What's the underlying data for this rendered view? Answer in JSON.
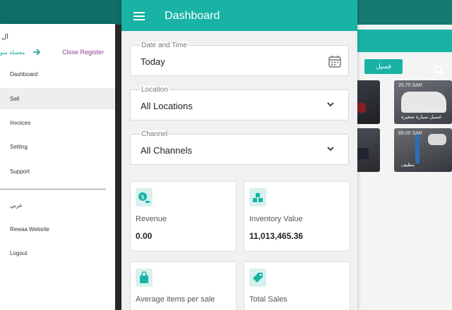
{
  "drawer": {
    "brand_text": "ال",
    "branch_text": "مغسلة سو",
    "close_register_label": "Close Register",
    "menu_items": [
      {
        "label": "Dashboard"
      },
      {
        "label": "Sell"
      },
      {
        "label": "Invoices"
      },
      {
        "label": "Setting"
      },
      {
        "label": "Support"
      }
    ],
    "secondary_items": [
      {
        "label": "عربي"
      },
      {
        "label": "Rewaa Website"
      },
      {
        "label": "Logout"
      }
    ]
  },
  "dashboard": {
    "title": "Dashboard",
    "filters": {
      "date": {
        "label": "Date and Time",
        "value": "Today"
      },
      "location": {
        "label": "Location",
        "value": "All Locations"
      },
      "channel": {
        "label": "Channel",
        "value": "All Channels"
      }
    },
    "cards": [
      {
        "label": "Revenue",
        "value": "0.00",
        "icon": "revenue-icon"
      },
      {
        "label": "Inventory Value",
        "value": "11,013,465.36",
        "icon": "inventory-icon"
      },
      {
        "label": "Average items per sale",
        "value": "",
        "icon": "shopping-bag-icon"
      },
      {
        "label": "Total Sales",
        "value": "",
        "icon": "price-tag-icon"
      }
    ]
  },
  "background_app": {
    "button_label": "فسيل",
    "tiles": [
      {
        "price": "",
        "name": ""
      },
      {
        "price": "25.75 SAR",
        "name": "غسيل سيارة صغيرة"
      },
      {
        "price": "",
        "name": ""
      },
      {
        "price": "89.00 SAR",
        "name": "تنظيف"
      }
    ]
  },
  "colors": {
    "primary": "#19b3a6",
    "primary_dark": "#147a72",
    "close_register": "#8e3e8e",
    "card_icon_bg": "#d8f1ee"
  }
}
